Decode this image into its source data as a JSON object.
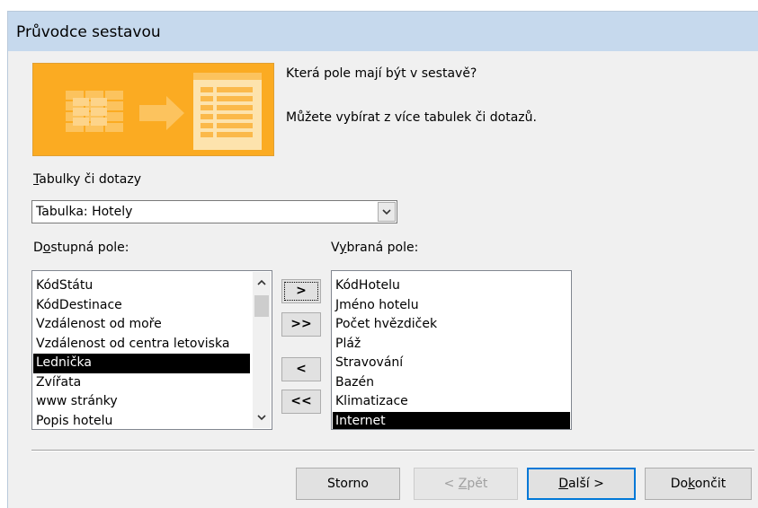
{
  "window": {
    "title": "Průvodce sestavou"
  },
  "intro": {
    "question": "Která pole mají být v sestavě?",
    "hint": "Můžete vybírat z více tabulek či dotazů."
  },
  "tables": {
    "label_key": "T",
    "label_rest": "abulky či dotazy",
    "selected": "Tabulka: Hotely"
  },
  "available": {
    "label_pre": "D",
    "label_key": "o",
    "label_rest": "stupná pole:",
    "items": [
      "KódStátu",
      "KódDestinace",
      "Vzdálenost od moře",
      "Vzdálenost od centra letoviska",
      "Lednička",
      "Zvířata",
      "www stránky",
      "Popis hotelu"
    ],
    "selected_index": 4
  },
  "selected_fields": {
    "label_pre": "V",
    "label_key": "y",
    "label_rest": "braná pole:",
    "items": [
      "KódHotelu",
      "Jméno hotelu",
      "Počet hvězdiček",
      "Pláž",
      "Stravování",
      "Bazén",
      "Klimatizace",
      "Internet"
    ],
    "selected_index": 7
  },
  "transfer": {
    "add_one": ">",
    "add_all": ">>",
    "remove_one": "<",
    "remove_all": "<<"
  },
  "buttons": {
    "cancel": "Storno",
    "back_pre": "< ",
    "back_key": "Z",
    "back_rest": "pět",
    "next_key": "D",
    "next_rest": "alší >",
    "finish_pre": "Do",
    "finish_key": "k",
    "finish_rest": "ončit"
  },
  "colors": {
    "titlebar": "#c6d9ed",
    "illustration_bg": "#fbab22",
    "selection": "#000000",
    "default_button_border": "#0078d7"
  },
  "icons": {
    "illustration": "report-wizard-illustration",
    "combo_arrow": "chevron-down-icon",
    "scroll_up": "chevron-up-icon",
    "scroll_down": "chevron-down-icon"
  }
}
